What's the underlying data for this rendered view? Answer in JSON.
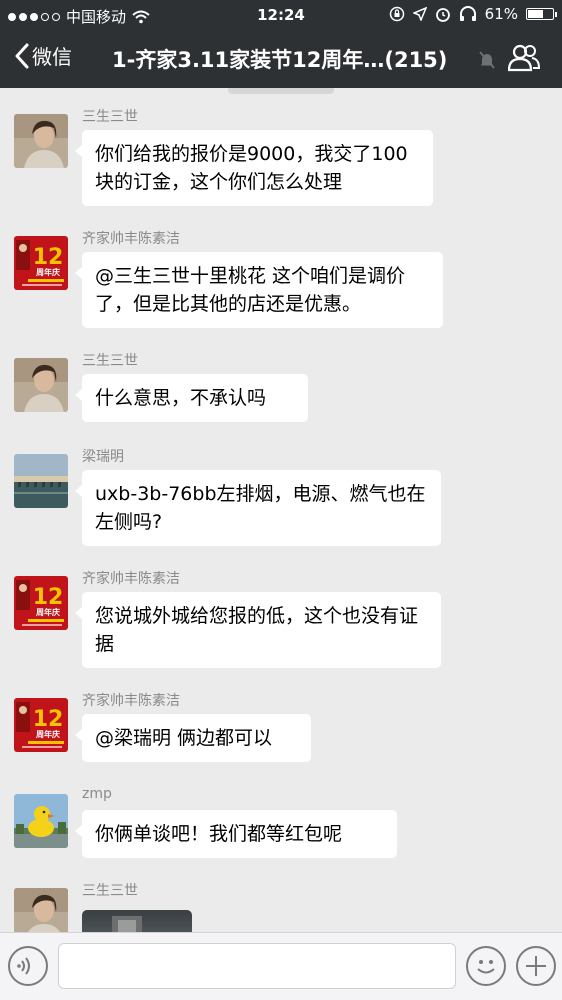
{
  "status_bar": {
    "carrier": "中国移动",
    "time": "12:24",
    "battery": "61%",
    "battery_level": 0.61
  },
  "nav": {
    "back_label": "微信",
    "title": "1-齐家3.11家装节12周年…(215)"
  },
  "messages": [
    {
      "sender": "三生三世",
      "text": "你们给我的报价是9000，我交了100块的订金，这个你们怎么处理",
      "avatar": "woman-photo"
    },
    {
      "sender": "齐家帅丰陈素洁",
      "text": "@三生三世十里桃花 这个咱们是调价了，但是比其他的店还是优惠。",
      "avatar": "anniversary-poster"
    },
    {
      "sender": "三生三世",
      "text": "什么意思，不承认吗",
      "avatar": "woman-photo"
    },
    {
      "sender": "梁瑞明",
      "text": "uxb-3b-76bb左排烟，电源、燃气也在左侧吗?",
      "avatar": "bridge-photo"
    },
    {
      "sender": "齐家帅丰陈素洁",
      "text": "您说城外城给您报的低，这个也没有证据",
      "avatar": "anniversary-poster"
    },
    {
      "sender": "齐家帅丰陈素洁",
      "text": "@梁瑞明 俩边都可以",
      "avatar": "anniversary-poster"
    },
    {
      "sender": "zmp",
      "text": "你俩单谈吧！我们都等红包呢",
      "avatar": "duck-photo"
    },
    {
      "sender": "三生三世",
      "text": "",
      "avatar": "woman-photo"
    }
  ],
  "poster_text": {
    "number": "12",
    "caption": "周年庆"
  },
  "input_bar": {
    "placeholder": ""
  },
  "colors": {
    "nav_bg": "#2e3133",
    "chat_bg": "#ebebeb",
    "bubble_bg": "#ffffff",
    "poster_red": "#c0141a",
    "poster_gold": "#f5c400"
  },
  "icons": [
    "back-chevron-icon",
    "mute-icon",
    "group-members-icon",
    "voice-icon",
    "emoji-icon",
    "plus-icon",
    "wifi-icon",
    "location-icon",
    "alarm-icon",
    "headphones-icon",
    "battery-icon"
  ]
}
